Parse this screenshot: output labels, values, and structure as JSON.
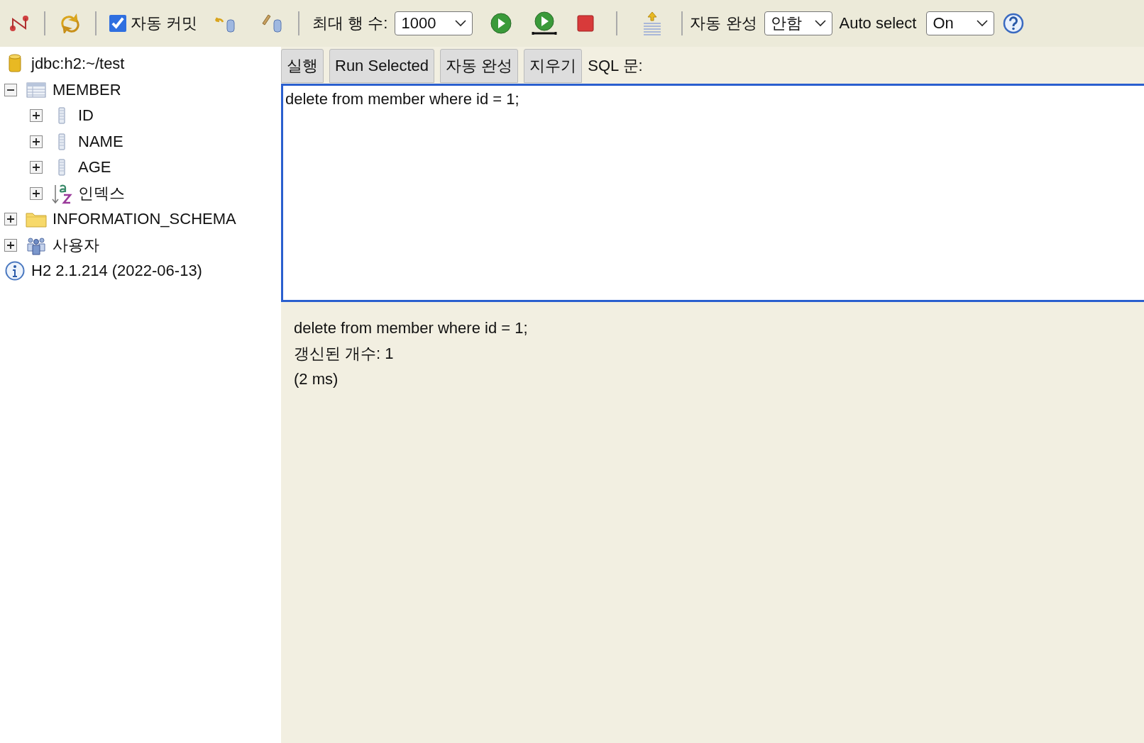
{
  "toolbar": {
    "auto_commit": {
      "label": "자동 커밋",
      "checked": true
    },
    "max_rows": {
      "label": "최대 행 수:",
      "value": "1000"
    },
    "autocomplete": {
      "label": "자동 완성",
      "value": "안함"
    },
    "auto_select": {
      "label": "Auto select",
      "value": "On"
    }
  },
  "tree": [
    {
      "kind": "connection",
      "label": "jdbc:h2:~/test"
    },
    {
      "kind": "table",
      "label": "MEMBER",
      "expanded": true,
      "children": [
        {
          "kind": "column",
          "label": "ID",
          "expanded": false
        },
        {
          "kind": "column",
          "label": "NAME",
          "expanded": false
        },
        {
          "kind": "column",
          "label": "AGE",
          "expanded": false
        },
        {
          "kind": "index",
          "label": "인덱스",
          "expanded": false
        }
      ]
    },
    {
      "kind": "schema",
      "label": "INFORMATION_SCHEMA",
      "expanded": false
    },
    {
      "kind": "users",
      "label": "사용자",
      "expanded": false
    },
    {
      "kind": "info",
      "label": "H2 2.1.214 (2022-06-13)"
    }
  ],
  "sql_buttons": [
    "실행",
    "Run Selected",
    "자동 완성",
    "지우기"
  ],
  "sql_label": "SQL 문:",
  "editor": {
    "value": "delete from member where id = 1;"
  },
  "result": {
    "lines": [
      "delete from member where id = 1;",
      "갱신된 개수: 1",
      "(2 ms)"
    ]
  }
}
